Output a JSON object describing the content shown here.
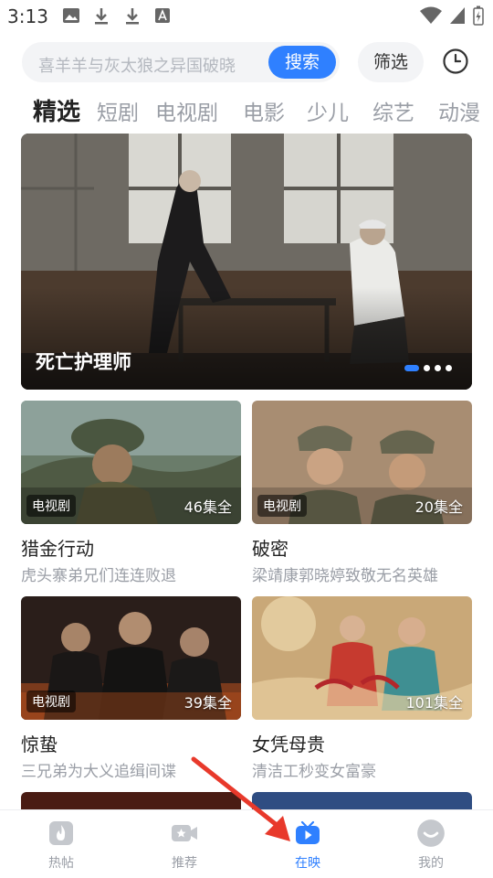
{
  "status_bar": {
    "time": "3:13"
  },
  "search": {
    "placeholder": "喜羊羊与灰太狼之异国破晓",
    "search_button": "搜索",
    "filter_button": "筛选"
  },
  "tabs": [
    "精选",
    "短剧",
    "电视剧",
    "电影",
    "少儿",
    "综艺",
    "动漫"
  ],
  "active_tab": "精选",
  "banner": {
    "title": "死亡护理师"
  },
  "cards": [
    {
      "title": "猎金行动",
      "subtitle": "虎头寨弟兄们连连败退",
      "type": "电视剧",
      "episodes": "46集全"
    },
    {
      "title": "破密",
      "subtitle": "梁靖康郭晓婷致敬无名英雄",
      "type": "电视剧",
      "episodes": "20集全"
    },
    {
      "title": "惊蛰",
      "subtitle": "三兄弟为大义追缉间谍",
      "type": "电视剧",
      "episodes": "39集全"
    },
    {
      "title": "女凭母贵",
      "subtitle": "清洁工秒变女富豪",
      "type": "",
      "episodes": "101集全"
    }
  ],
  "bottom_nav": [
    {
      "label": "热帖",
      "icon": "flame-icon"
    },
    {
      "label": "推荐",
      "icon": "video-camera-icon"
    },
    {
      "label": "在映",
      "icon": "tv-play-icon"
    },
    {
      "label": "我的",
      "icon": "smiley-icon"
    }
  ],
  "active_nav": "在映",
  "colors": {
    "accent": "#2f80ff",
    "muted": "#9a9ea6",
    "annotation": "#e8392b"
  }
}
